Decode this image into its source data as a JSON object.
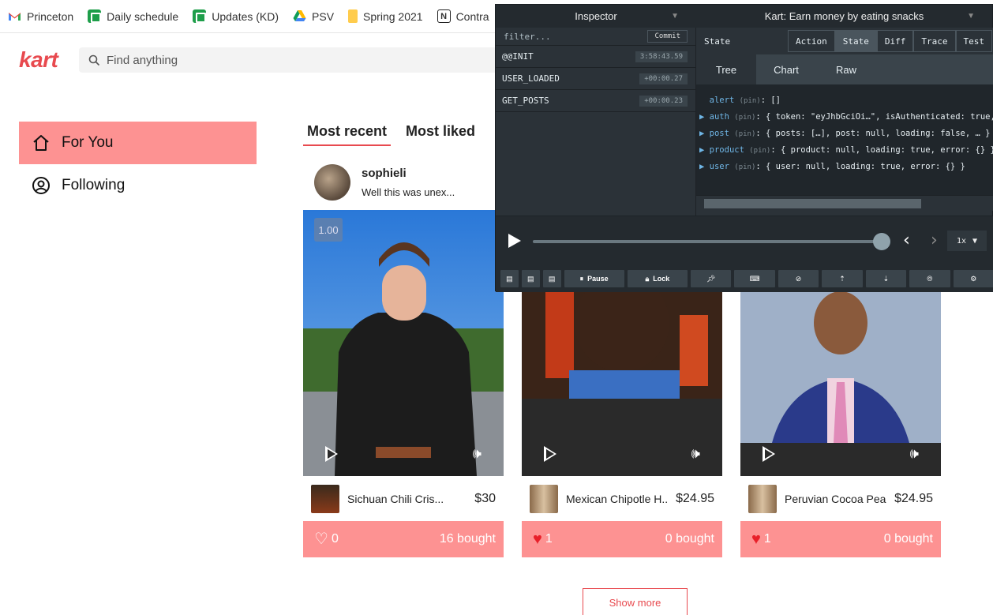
{
  "bookmarks": [
    {
      "label": "Princeton",
      "icon": "gmail-icon"
    },
    {
      "label": "Daily schedule",
      "icon": "sheets-icon"
    },
    {
      "label": "Updates (KD)",
      "icon": "sheets-icon"
    },
    {
      "label": "PSV",
      "icon": "drive-icon"
    },
    {
      "label": "Spring 2021",
      "icon": "folder-icon"
    },
    {
      "label": "Contra",
      "icon": "notion-icon"
    }
  ],
  "header": {
    "logo": "kart",
    "search_placeholder": "Find anything"
  },
  "sidebar": {
    "items": [
      {
        "label": "For You",
        "active": true
      },
      {
        "label": "Following",
        "active": false
      }
    ]
  },
  "feed": {
    "tabs": [
      {
        "label": "Most recent",
        "active": true
      },
      {
        "label": "Most liked",
        "active": false
      }
    ],
    "cards": [
      {
        "username": "sophieli",
        "caption": "Well this was unex...",
        "playback_speed": "1.00",
        "product_name": "Sichuan Chili Cris...",
        "price": "$30",
        "likes": "0",
        "liked": false,
        "bought": "16 bought"
      },
      {
        "product_name": "Mexican Chipotle H...",
        "price": "$24.95",
        "likes": "1",
        "liked": true,
        "bought": "0 bought"
      },
      {
        "product_name": "Peruvian Cocoa Pea...",
        "price": "$24.95",
        "likes": "1",
        "liked": true,
        "bought": "0 bought"
      }
    ],
    "show_more": "Show more"
  },
  "inspector": {
    "left_title": "Inspector",
    "right_title": "Kart: Earn money by eating snacks",
    "filter_placeholder": "filter...",
    "commit": "Commit",
    "actions": [
      {
        "name": "@@INIT",
        "time": "3:58:43.59"
      },
      {
        "name": "USER_LOADED",
        "time": "+00:00.27"
      },
      {
        "name": "GET_POSTS",
        "time": "+00:00.23"
      }
    ],
    "state_label": "State",
    "mode_tabs": [
      {
        "label": "Action",
        "active": false
      },
      {
        "label": "State",
        "active": true
      },
      {
        "label": "Diff",
        "active": false
      },
      {
        "label": "Trace",
        "active": false
      },
      {
        "label": "Test",
        "active": false
      }
    ],
    "view_tabs": [
      {
        "label": "Tree",
        "active": true
      },
      {
        "label": "Chart",
        "active": false
      },
      {
        "label": "Raw",
        "active": false
      }
    ],
    "tree": [
      {
        "key": "alert",
        "pin": "(pin)",
        "value": ": []",
        "expandable": false
      },
      {
        "key": "auth",
        "pin": "(pin)",
        "value": ": { token: \"eyJhbGciOi…\", isAuthenticated: true, lo",
        "expandable": true
      },
      {
        "key": "post",
        "pin": "(pin)",
        "value": ": { posts: […], post: null, loading: false, … }",
        "expandable": true
      },
      {
        "key": "product",
        "pin": "(pin)",
        "value": ": { product: null, loading: true, error: {} }",
        "expandable": true
      },
      {
        "key": "user",
        "pin": "(pin)",
        "value": ": { user: null, loading: true, error: {} }",
        "expandable": true
      }
    ],
    "speed": "1x",
    "toolbar": {
      "pause": "Pause",
      "lock": "Lock"
    }
  },
  "colors": {
    "brand": "#e84a4f",
    "accent_pink": "#fd9292",
    "devtools_bg": "#2b3238"
  }
}
